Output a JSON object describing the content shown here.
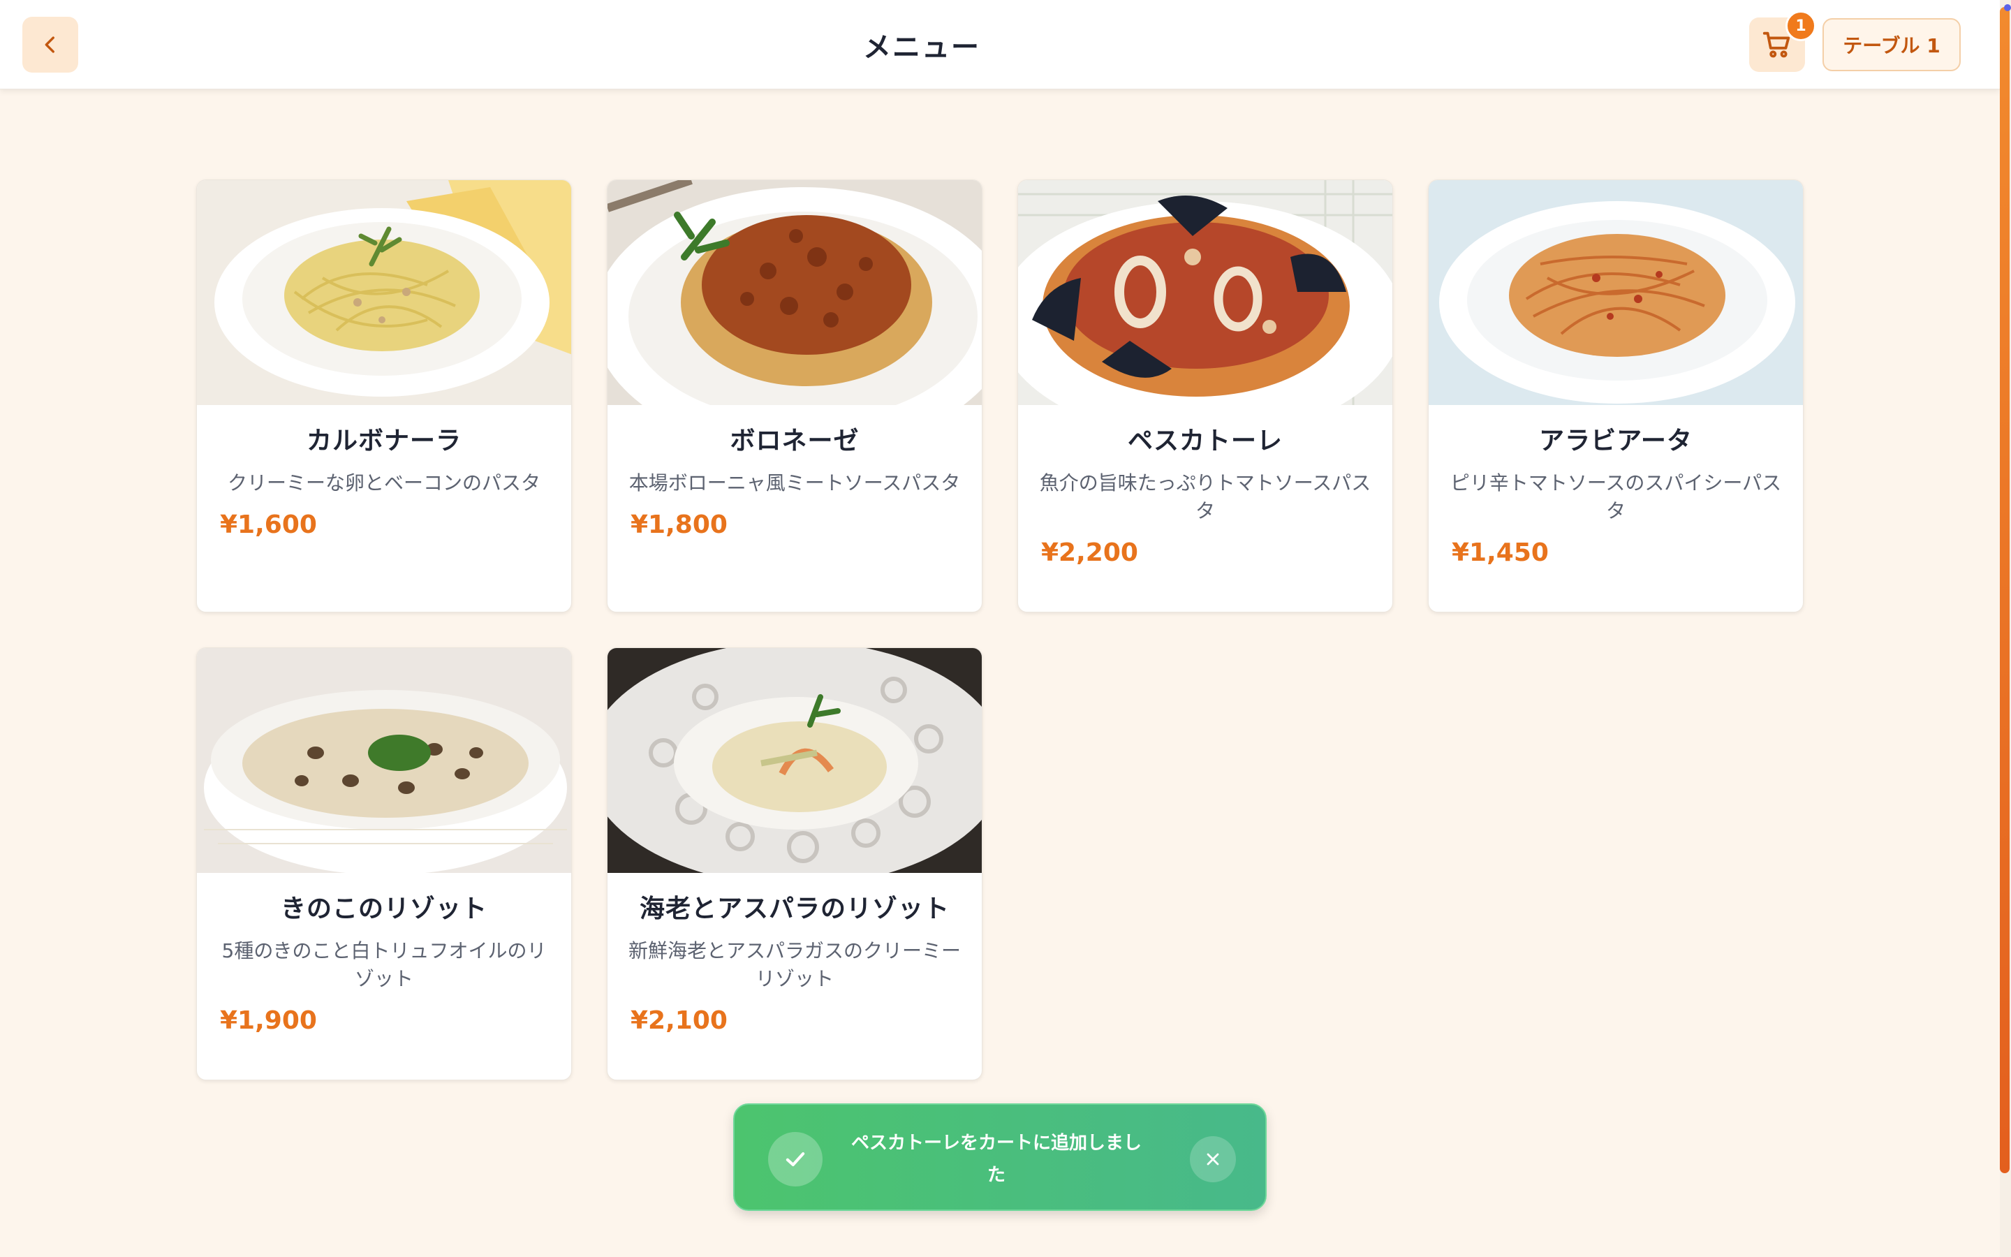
{
  "header": {
    "title": "メニュー",
    "back_icon": "chevron-left-icon",
    "cart_icon": "cart-icon",
    "cart_count": "1",
    "table_label": "テーブル 1"
  },
  "colors": {
    "accent": "#e8731c",
    "header_button_bg": "#fde8d2",
    "page_bg": "#fdf5ec",
    "toast_bg": "#4cc46e"
  },
  "menu": {
    "items": [
      {
        "name": "カルボナーラ",
        "description": "クリーミーな卵とベーコンのパスタ",
        "price": "¥1,600"
      },
      {
        "name": "ボロネーゼ",
        "description": "本場ボローニャ風ミートソースパスタ",
        "price": "¥1,800"
      },
      {
        "name": "ペスカトーレ",
        "description": "魚介の旨味たっぷりトマトソースパスタ",
        "price": "¥2,200"
      },
      {
        "name": "アラビアータ",
        "description": "ピリ辛トマトソースのスパイシーパスタ",
        "price": "¥1,450"
      },
      {
        "name": "きのこのリゾット",
        "description": "5種のきのこと白トリュフオイルのリゾット",
        "price": "¥1,900"
      },
      {
        "name": "海老とアスパラのリゾット",
        "description": "新鮮海老とアスパラガスのクリーミーリゾット",
        "price": "¥2,100"
      }
    ]
  },
  "toast": {
    "message": "ペスカトーレをカートに追加しました",
    "check_icon": "check-icon",
    "close_icon": "close-icon"
  }
}
